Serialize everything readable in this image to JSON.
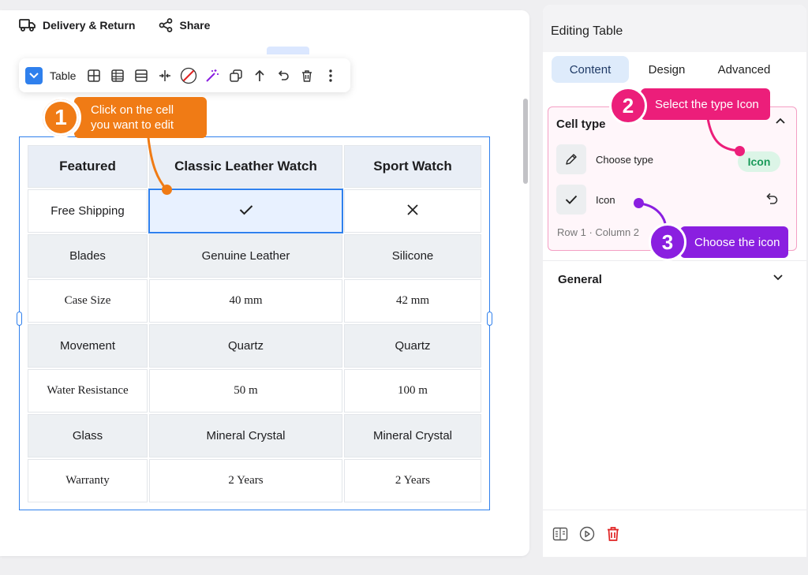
{
  "topbar": {
    "delivery_label": "Delivery & Return",
    "share_label": "Share"
  },
  "toolbar": {
    "label": "Table"
  },
  "table": {
    "headers": [
      "Featured",
      "Classic Leather Watch",
      "Sport Watch"
    ],
    "rows": [
      [
        "Free Shipping",
        "",
        ""
      ],
      [
        "Blades",
        "Genuine Leather",
        "Silicone"
      ],
      [
        "Case Size",
        "40 mm",
        "42 mm"
      ],
      [
        "Movement",
        "Quartz",
        "Quartz"
      ],
      [
        "Water Resistance",
        "50 m",
        "100 m"
      ],
      [
        "Glass",
        "Mineral Crystal",
        "Mineral Crystal"
      ],
      [
        "Warranty",
        "2 Years",
        "2 Years"
      ]
    ]
  },
  "callouts": {
    "step1_number": "1",
    "step1_line1": "Click on the cell",
    "step1_line2": "you want to edit",
    "step2_number": "2",
    "step2_text": "Select the type Icon",
    "step3_number": "3",
    "step3_text": "Choose the icon"
  },
  "panel": {
    "title": "Editing Table",
    "tabs": [
      "Content",
      "Design",
      "Advanced"
    ],
    "cell_type_header": "Cell type",
    "choose_type_label": "Choose type",
    "choose_type_value": "Icon",
    "icon_label": "Icon",
    "row_col": "Row 1 · Column 2",
    "general_label": "General"
  },
  "colors": {
    "accent": "#2f80ed",
    "step1": "#f07b15",
    "step2": "#ec1e7a",
    "step3": "#8a1fe0",
    "pill_bg": "#dcf5e7",
    "pill_text": "#1a9a5a",
    "delete": "#e02424"
  }
}
